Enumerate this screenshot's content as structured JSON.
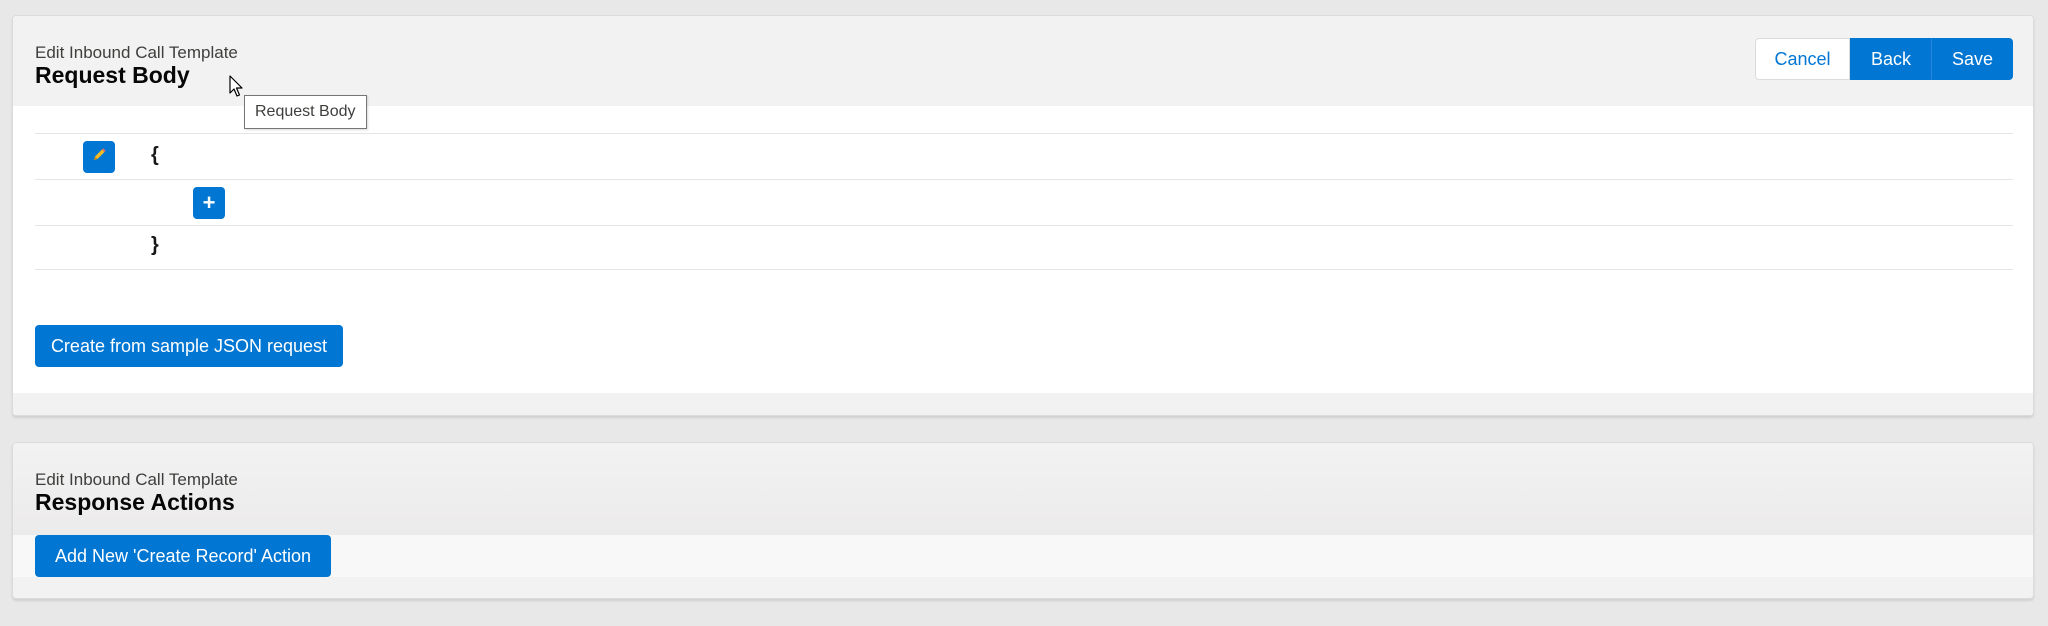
{
  "request_body": {
    "eyebrow": "Edit Inbound Call Template",
    "title": "Request Body",
    "buttons": {
      "cancel": "Cancel",
      "back": "Back",
      "save": "Save"
    },
    "tooltip": "Request Body",
    "json_rows": {
      "open_brace": "{",
      "close_brace": "}",
      "add_symbol": "+"
    },
    "create_button": "Create from sample JSON request"
  },
  "response_actions": {
    "eyebrow": "Edit Inbound Call Template",
    "title": "Response Actions",
    "add_button": "Add New 'Create Record' Action"
  },
  "colors": {
    "brand": "#0176d3",
    "background": "#e9e8e8",
    "header": "#f3f2f2"
  },
  "icons": [
    "edit-icon",
    "plus-icon",
    "mouse-cursor-icon"
  ]
}
